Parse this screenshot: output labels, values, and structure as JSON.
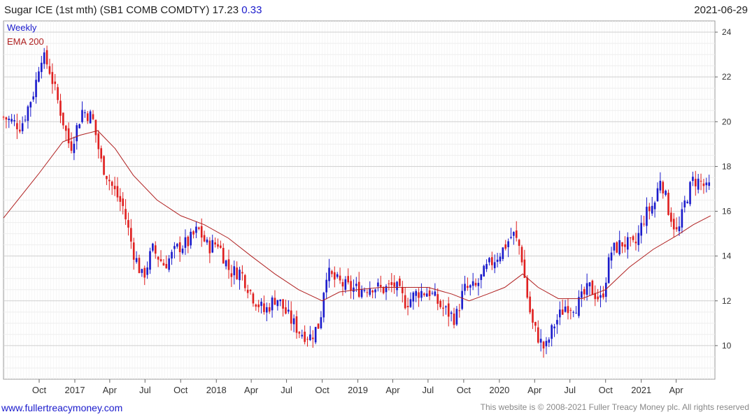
{
  "header": {
    "symbol": "Sugar ICE (1st mth)  (SB1 COMB COMDTY)",
    "last": "17.23",
    "change": "0.33",
    "date": "2021-06-29"
  },
  "footer": {
    "site": "www.fullertreacymoney.com",
    "copyright": "This website is © 2008-2021 Fuller Treacy Money plc. All rights reserved"
  },
  "colors": {
    "up": "#1a1acc",
    "down": "#e01e1e",
    "ema": "#b02020",
    "grid": "#d8d8d8"
  },
  "chart_data": {
    "type": "candlestick",
    "legend": [
      "Weekly",
      "EMA 200"
    ],
    "y_ticks": [
      10,
      12,
      14,
      16,
      18,
      20,
      22,
      24
    ],
    "y_range": [
      8.5,
      24.5
    ],
    "x_range": [
      "2016-07-01",
      "2021-07-10"
    ],
    "x_ticks": [
      {
        "label": "Oct",
        "date": "2016-10-01"
      },
      {
        "label": "2017",
        "date": "2017-01-01"
      },
      {
        "label": "Apr",
        "date": "2017-04-01"
      },
      {
        "label": "Jul",
        "date": "2017-07-01"
      },
      {
        "label": "Oct",
        "date": "2017-10-01"
      },
      {
        "label": "2018",
        "date": "2018-01-01"
      },
      {
        "label": "Apr",
        "date": "2018-04-01"
      },
      {
        "label": "Jul",
        "date": "2018-07-01"
      },
      {
        "label": "Oct",
        "date": "2018-10-01"
      },
      {
        "label": "2019",
        "date": "2019-01-01"
      },
      {
        "label": "Apr",
        "date": "2019-04-01"
      },
      {
        "label": "Jul",
        "date": "2019-07-01"
      },
      {
        "label": "Oct",
        "date": "2019-10-01"
      },
      {
        "label": "2020",
        "date": "2020-01-01"
      },
      {
        "label": "Apr",
        "date": "2020-04-01"
      },
      {
        "label": "Jul",
        "date": "2020-07-01"
      },
      {
        "label": "Oct",
        "date": "2020-10-01"
      },
      {
        "label": "2021",
        "date": "2021-01-01"
      },
      {
        "label": "Apr",
        "date": "2021-04-01"
      }
    ],
    "close_path": [
      [
        "2016-07-01",
        20.2
      ],
      [
        "2016-08-15",
        19.8
      ],
      [
        "2016-09-20",
        21.5
      ],
      [
        "2016-10-05",
        23.0
      ],
      [
        "2016-10-25",
        22.5
      ],
      [
        "2016-11-20",
        20.8
      ],
      [
        "2016-12-20",
        18.8
      ],
      [
        "2017-01-20",
        20.5
      ],
      [
        "2017-02-15",
        20.2
      ],
      [
        "2017-03-10",
        18.2
      ],
      [
        "2017-04-10",
        17.0
      ],
      [
        "2017-05-05",
        16.2
      ],
      [
        "2017-06-01",
        14.2
      ],
      [
        "2017-06-25",
        13.0
      ],
      [
        "2017-07-20",
        14.3
      ],
      [
        "2017-08-20",
        13.6
      ],
      [
        "2017-09-25",
        14.4
      ],
      [
        "2017-10-20",
        14.6
      ],
      [
        "2017-11-15",
        15.2
      ],
      [
        "2017-12-10",
        14.4
      ],
      [
        "2018-01-05",
        14.6
      ],
      [
        "2018-02-05",
        13.3
      ],
      [
        "2018-03-05",
        13.3
      ],
      [
        "2018-04-05",
        12.2
      ],
      [
        "2018-05-05",
        11.5
      ],
      [
        "2018-06-05",
        12.2
      ],
      [
        "2018-07-05",
        11.3
      ],
      [
        "2018-08-05",
        10.6
      ],
      [
        "2018-09-01",
        10.4
      ],
      [
        "2018-09-25",
        11.0
      ],
      [
        "2018-10-10",
        13.3
      ],
      [
        "2018-11-05",
        12.9
      ],
      [
        "2018-12-05",
        12.6
      ],
      [
        "2019-01-05",
        12.5
      ],
      [
        "2019-02-05",
        12.7
      ],
      [
        "2019-03-05",
        12.5
      ],
      [
        "2019-04-05",
        12.7
      ],
      [
        "2019-05-05",
        11.9
      ],
      [
        "2019-06-05",
        12.4
      ],
      [
        "2019-07-05",
        12.4
      ],
      [
        "2019-08-05",
        11.7
      ],
      [
        "2019-09-10",
        11.2
      ],
      [
        "2019-10-01",
        12.5
      ],
      [
        "2019-11-01",
        12.6
      ],
      [
        "2019-12-01",
        13.5
      ],
      [
        "2020-01-10",
        14.3
      ],
      [
        "2020-02-05",
        15.0
      ],
      [
        "2020-02-25",
        14.3
      ],
      [
        "2020-03-10",
        12.5
      ],
      [
        "2020-03-25",
        11.0
      ],
      [
        "2020-04-15",
        10.2
      ],
      [
        "2020-04-28",
        9.8
      ],
      [
        "2020-05-20",
        10.9
      ],
      [
        "2020-06-20",
        11.8
      ],
      [
        "2020-07-20",
        11.8
      ],
      [
        "2020-08-20",
        12.6
      ],
      [
        "2020-09-20",
        12.0
      ],
      [
        "2020-10-15",
        14.2
      ],
      [
        "2020-11-15",
        14.6
      ],
      [
        "2020-12-15",
        14.4
      ],
      [
        "2021-01-10",
        15.8
      ],
      [
        "2021-02-05",
        16.4
      ],
      [
        "2021-02-20",
        17.6
      ],
      [
        "2021-03-10",
        16.2
      ],
      [
        "2021-04-05",
        14.9
      ],
      [
        "2021-04-25",
        16.5
      ],
      [
        "2021-05-15",
        17.4
      ],
      [
        "2021-06-05",
        17.3
      ],
      [
        "2021-06-20",
        16.9
      ],
      [
        "2021-06-29",
        17.23
      ]
    ],
    "ema_path": [
      [
        "2016-07-01",
        15.7
      ],
      [
        "2016-10-01",
        17.7
      ],
      [
        "2016-12-01",
        19.1
      ],
      [
        "2017-01-15",
        19.4
      ],
      [
        "2017-03-01",
        19.6
      ],
      [
        "2017-04-15",
        18.8
      ],
      [
        "2017-06-01",
        17.6
      ],
      [
        "2017-08-01",
        16.5
      ],
      [
        "2017-10-01",
        15.8
      ],
      [
        "2017-12-01",
        15.4
      ],
      [
        "2018-02-01",
        14.8
      ],
      [
        "2018-04-01",
        14.0
      ],
      [
        "2018-06-01",
        13.2
      ],
      [
        "2018-08-01",
        12.5
      ],
      [
        "2018-10-01",
        12.0
      ],
      [
        "2018-11-15",
        12.4
      ],
      [
        "2019-01-01",
        12.5
      ],
      [
        "2019-03-01",
        12.6
      ],
      [
        "2019-05-01",
        12.6
      ],
      [
        "2019-07-01",
        12.6
      ],
      [
        "2019-09-01",
        12.3
      ],
      [
        "2019-10-15",
        12.0
      ],
      [
        "2019-12-01",
        12.3
      ],
      [
        "2020-01-15",
        12.6
      ],
      [
        "2020-03-01",
        13.2
      ],
      [
        "2020-04-10",
        12.6
      ],
      [
        "2020-06-01",
        12.1
      ],
      [
        "2020-08-01",
        12.1
      ],
      [
        "2020-10-01",
        12.5
      ],
      [
        "2020-12-01",
        13.5
      ],
      [
        "2021-02-01",
        14.3
      ],
      [
        "2021-04-01",
        14.9
      ],
      [
        "2021-05-15",
        15.4
      ],
      [
        "2021-06-29",
        15.8
      ]
    ]
  }
}
